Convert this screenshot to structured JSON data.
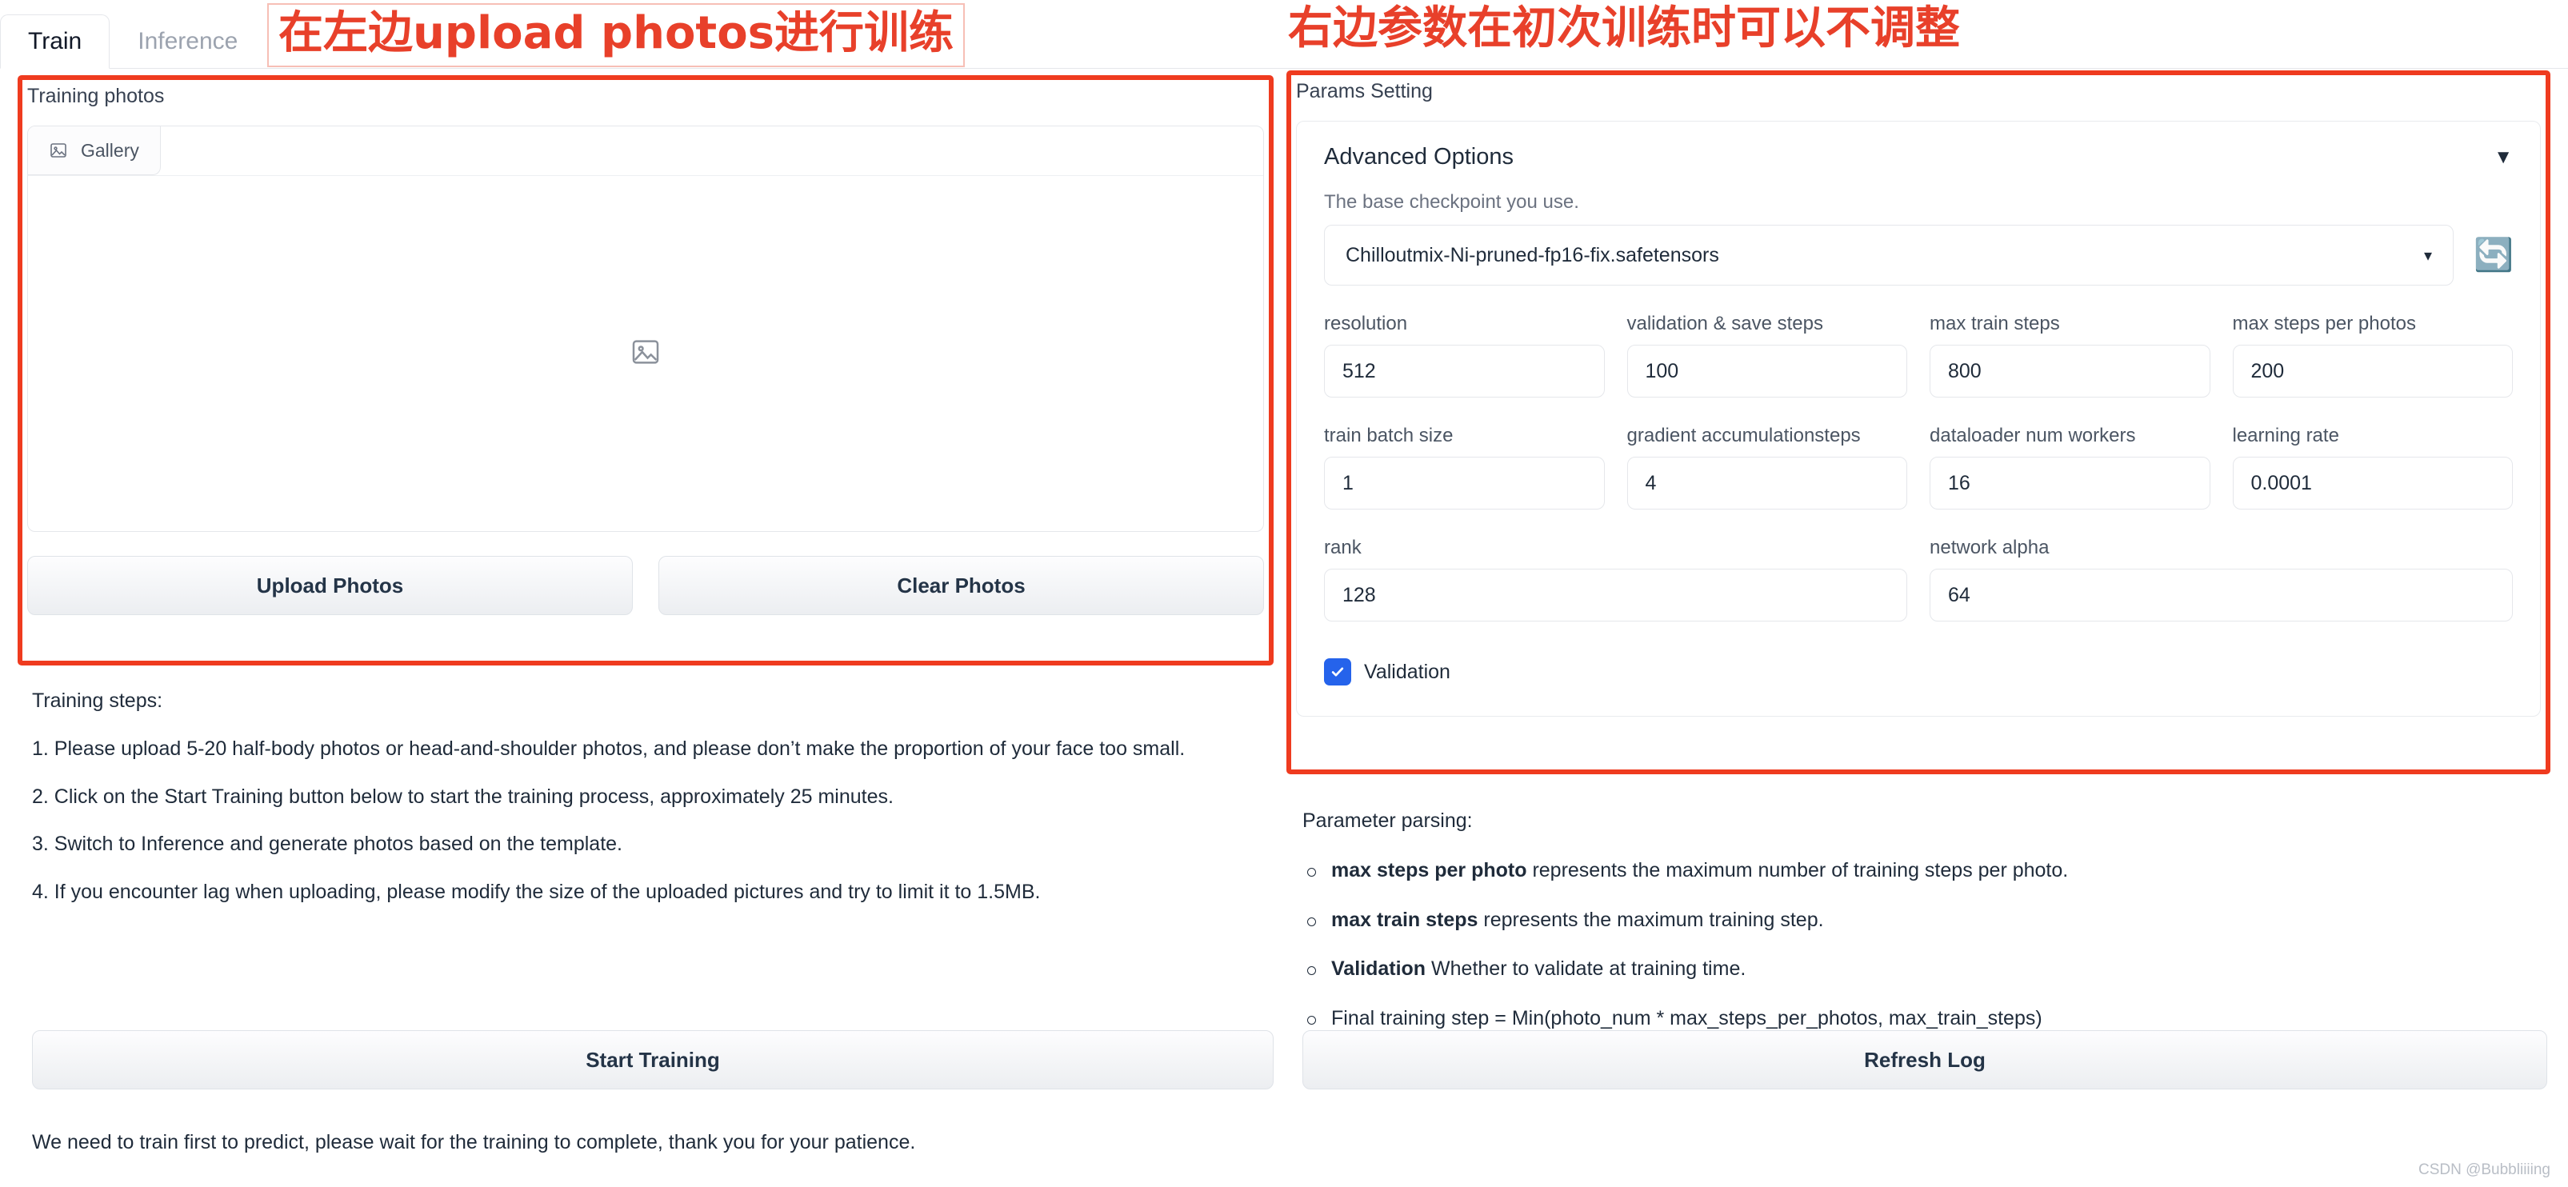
{
  "tabs": [
    {
      "label": "Train",
      "active": true
    },
    {
      "label": "Inference",
      "active": false
    }
  ],
  "annotations": {
    "left": "在左边upload photos进行训练",
    "right": "右边参数在初次训练时可以不调整",
    "color": "#e8402a"
  },
  "left_panel": {
    "label": "Training photos",
    "gallery_tab": "Gallery",
    "gallery_icon": "image-placeholder-icon",
    "upload_button": "Upload Photos",
    "clear_button": "Clear Photos",
    "steps_title": "Training steps:",
    "steps": [
      "1. Please upload 5-20 half-body photos or head-and-shoulder photos, and please don’t make the proportion of your face too small.",
      "2. Click on the Start Training button below to start the training process, approximately 25 minutes.",
      "3. Switch to Inference and generate photos based on the template.",
      "4. If you encounter lag when uploading, please modify the size of the uploaded pictures and try to limit it to 1.5MB."
    ],
    "start_training_button": "Start Training",
    "footer_note": "We need to train first to predict, please wait for the training to complete, thank you for your patience."
  },
  "right_panel": {
    "label": "Params Setting",
    "accordion_title": "Advanced Options",
    "accordion_caret": "▼",
    "checkpoint_hint": "The base checkpoint you use.",
    "checkpoint_value": "Chilloutmix-Ni-pruned-fp16-fix.safetensors",
    "checkpoint_caret": "▾",
    "refresh_icon": "🔄",
    "fields_row1": [
      {
        "label": "resolution",
        "value": "512"
      },
      {
        "label": "validation & save steps",
        "value": "100"
      },
      {
        "label": "max train steps",
        "value": "800"
      },
      {
        "label": "max steps per photos",
        "value": "200"
      }
    ],
    "fields_row2": [
      {
        "label": "train batch size",
        "value": "1"
      },
      {
        "label": "gradient accumulationsteps",
        "value": "4"
      },
      {
        "label": "dataloader num workers",
        "value": "16"
      },
      {
        "label": "learning rate",
        "value": "0.0001"
      }
    ],
    "fields_row3": [
      {
        "label": "rank",
        "value": "128"
      },
      {
        "label": "network alpha",
        "value": "64"
      }
    ],
    "validation_label": "Validation",
    "validation_checked": true,
    "validation_color": "#2563eb",
    "parsing_title": "Parameter parsing:",
    "parsing_items": [
      {
        "bold": "max steps per photo",
        "rest": " represents the maximum number of training steps per photo."
      },
      {
        "bold": "max train steps",
        "rest": " represents the maximum training step."
      },
      {
        "bold": "Validation",
        "rest": " Whether to validate at training time."
      },
      {
        "bold": "",
        "rest": "Final training step = Min(photo_num * max_steps_per_photos, max_train_steps)"
      }
    ],
    "refresh_log_button": "Refresh Log"
  },
  "watermark": "CSDN @Bubbliiiing"
}
